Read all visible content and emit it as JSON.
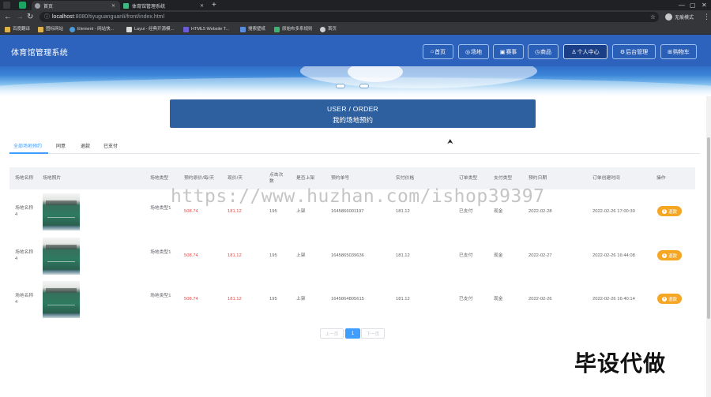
{
  "browser": {
    "tabs": [
      {
        "title": "首页",
        "active": true
      },
      {
        "title": "体育馆管理系统",
        "active": false
      }
    ],
    "new_tab": "+",
    "url_host": "localhost",
    "url_path": ":8080/tiyuguanguanli/front/index.html",
    "profile": "无痕模式",
    "bookmarks": [
      "百度翻译",
      "图标网站",
      "Element - 网站快...",
      "Layui - 经典开源模...",
      "HTML5 Website T...",
      "搜索壁纸",
      "原始布多系规则",
      "首页"
    ]
  },
  "header": {
    "title": "体育馆管理系统",
    "nav": [
      {
        "icon": "home-icon",
        "label": "首页"
      },
      {
        "icon": "venue-icon",
        "label": "场地"
      },
      {
        "icon": "match-icon",
        "label": "赛事"
      },
      {
        "icon": "goods-icon",
        "label": "商品"
      },
      {
        "icon": "user-icon",
        "label": "个人中心",
        "active": true
      },
      {
        "icon": "admin-icon",
        "label": "后台管理"
      },
      {
        "icon": "cart-icon",
        "label": "购物车"
      }
    ]
  },
  "page": {
    "title_en": "USER / ORDER",
    "title_cn": "我的场地预约"
  },
  "filter_tabs": [
    "全部场地预约",
    "同意",
    "退款",
    "已支付"
  ],
  "table": {
    "headers": [
      "场地名称",
      "场地照片",
      "场地类型",
      "预约原价/每/天",
      "现价/天",
      "点击次数",
      "是否上架",
      "预约单号",
      "实付价格",
      "订单类型",
      "支付类型",
      "预约日期",
      "订单创建时间",
      "操作"
    ],
    "rows": [
      {
        "name": "场地名称4",
        "type": "场地类型1",
        "orig_price": "508.74",
        "price": "181.12",
        "clicks": "195",
        "listed": "上架",
        "order_no": "1645866001197",
        "paid": "181.12",
        "order_type": "已支付",
        "pay_type": "现金",
        "date": "2022-02-28",
        "created": "2022-02-26 17:00:30",
        "action": "退款"
      },
      {
        "name": "场地名称4",
        "type": "场地类型1",
        "orig_price": "508.74",
        "price": "181.12",
        "clicks": "195",
        "listed": "上架",
        "order_no": "1645865039636",
        "paid": "181.12",
        "order_type": "已支付",
        "pay_type": "现金",
        "date": "2022-02-27",
        "created": "2022-02-26 16:44:08",
        "action": "退款"
      },
      {
        "name": "场地名称4",
        "type": "场地类型1",
        "orig_price": "508.74",
        "price": "181.12",
        "clicks": "195",
        "listed": "上架",
        "order_no": "1645864805615",
        "paid": "181.12",
        "order_type": "已支付",
        "pay_type": "现金",
        "date": "2022-02-26",
        "created": "2022-02-26 16:40:14",
        "action": "退款"
      }
    ]
  },
  "pagination": {
    "prev": "上一页",
    "current": "1",
    "next": "下一页"
  },
  "overlay": {
    "watermark": "https://www.huzhan.com/ishop39397",
    "stamp": "毕设代做"
  },
  "colors": {
    "header_bg": "#2d63bd",
    "accent": "#409eff",
    "price_red": "#e8473f",
    "action_orange": "#f5a623",
    "title_box": "#2e5f9e"
  }
}
